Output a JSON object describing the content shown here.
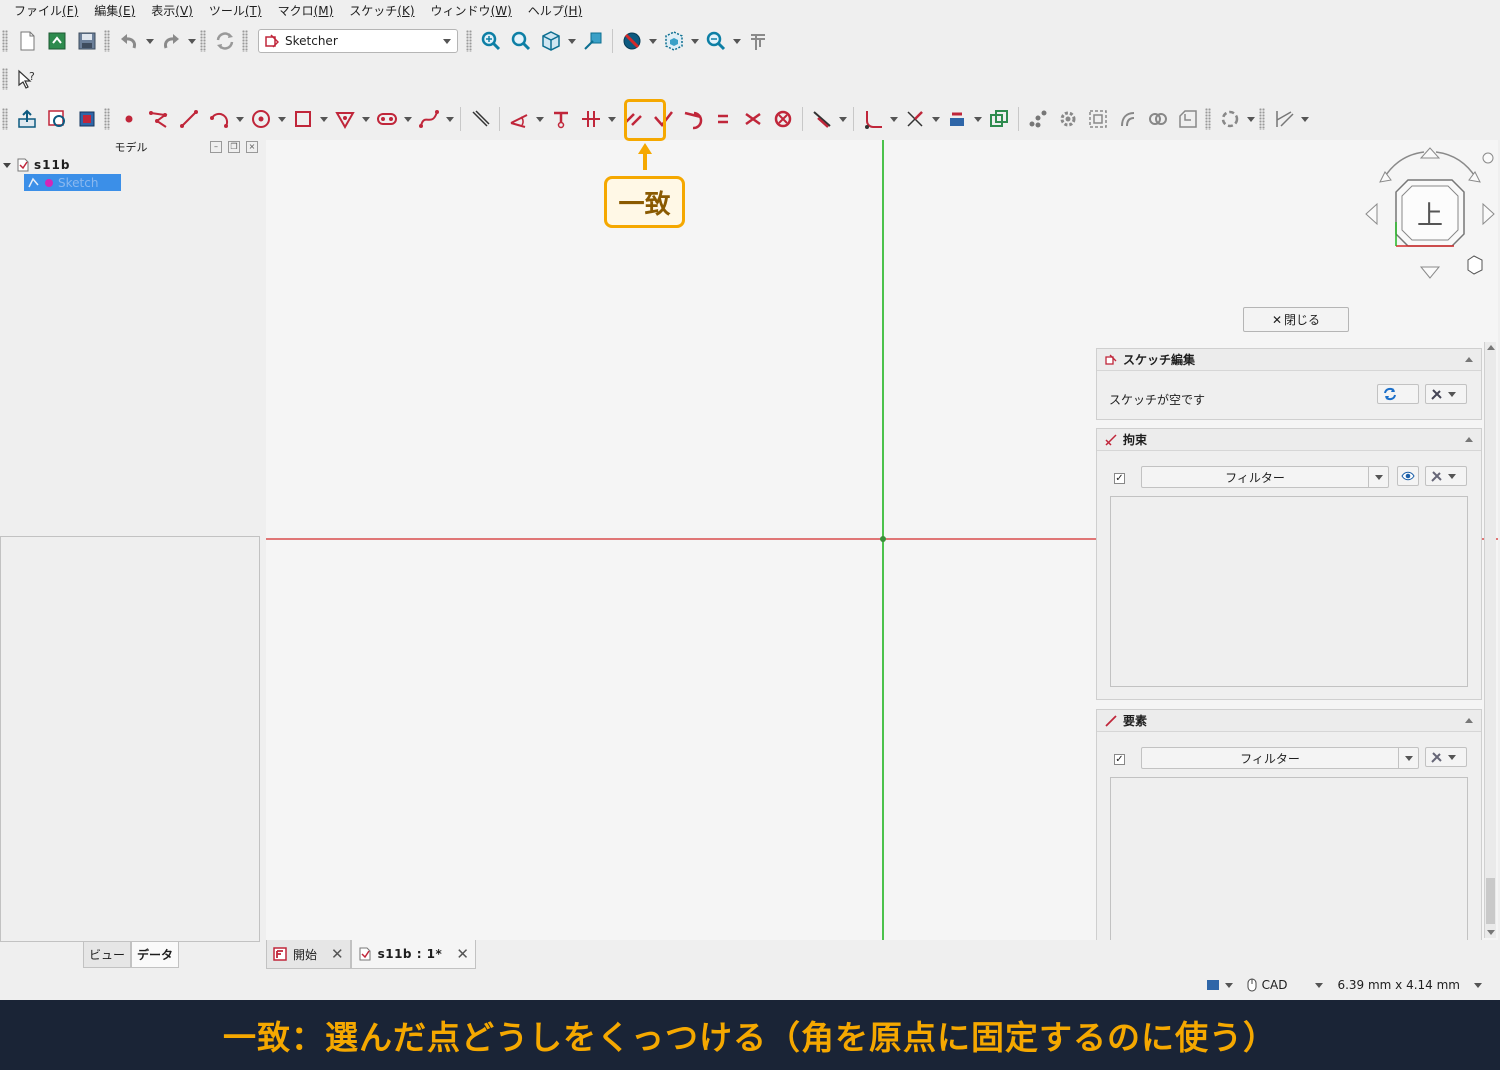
{
  "menu": [
    {
      "label": "ファイル",
      "key": "(F)"
    },
    {
      "label": "編集",
      "key": "(E)"
    },
    {
      "label": "表示",
      "key": "(V)"
    },
    {
      "label": "ツール",
      "key": "(T)"
    },
    {
      "label": "マクロ",
      "key": "(M)"
    },
    {
      "label": "スケッチ",
      "key": "(K)"
    },
    {
      "label": "ウィンドウ",
      "key": "(W)"
    },
    {
      "label": "ヘルプ",
      "key": "(H)"
    }
  ],
  "workbench": {
    "selected": "Sketcher"
  },
  "left_panel": {
    "title": "モデル",
    "tree": {
      "root": "s11b",
      "child": "Sketch"
    },
    "tabs": [
      "ビュー",
      "データ"
    ]
  },
  "task_panel": {
    "close_label": "閉じる",
    "sketch_edit": {
      "title": "スケッチ編集",
      "status": "スケッチが空です"
    },
    "constraints": {
      "title": "拘束",
      "filter": "フィルター"
    },
    "elements": {
      "title": "要素",
      "filter": "フィルター"
    }
  },
  "navcube": {
    "face": "上"
  },
  "doc_tabs": [
    {
      "label": "開始",
      "active": false
    },
    {
      "label": "s11b : 1*",
      "active": true
    }
  ],
  "status_bar": {
    "nav_style": "CAD",
    "dimensions": "6.39 mm x 4.14 mm"
  },
  "callout": {
    "label": "一致"
  },
  "caption": "一致：選んだ点どうしをくっつける（角を原点に固定するのに使う）",
  "colors": {
    "accent": "#f5a800",
    "x_axis": "#d42a2a",
    "y_axis": "#22b522",
    "selection": "#3b8fe8",
    "caption_bg": "#1a2436"
  }
}
